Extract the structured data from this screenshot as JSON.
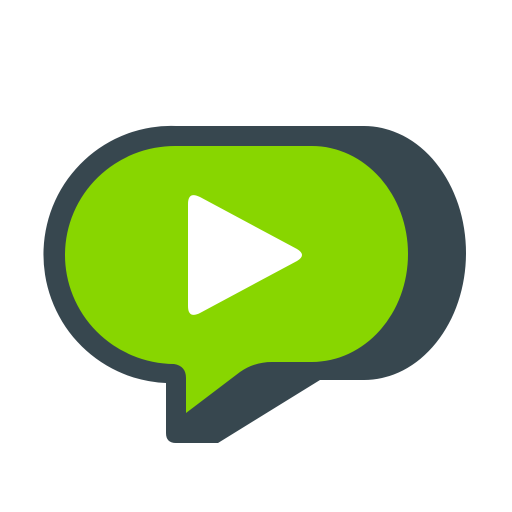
{
  "icon": {
    "name": "video-chat-bubble-icon",
    "colors": {
      "background": "#ffffff",
      "outline": "#37474f",
      "fill": "#88d600",
      "play": "#ffffff"
    }
  }
}
